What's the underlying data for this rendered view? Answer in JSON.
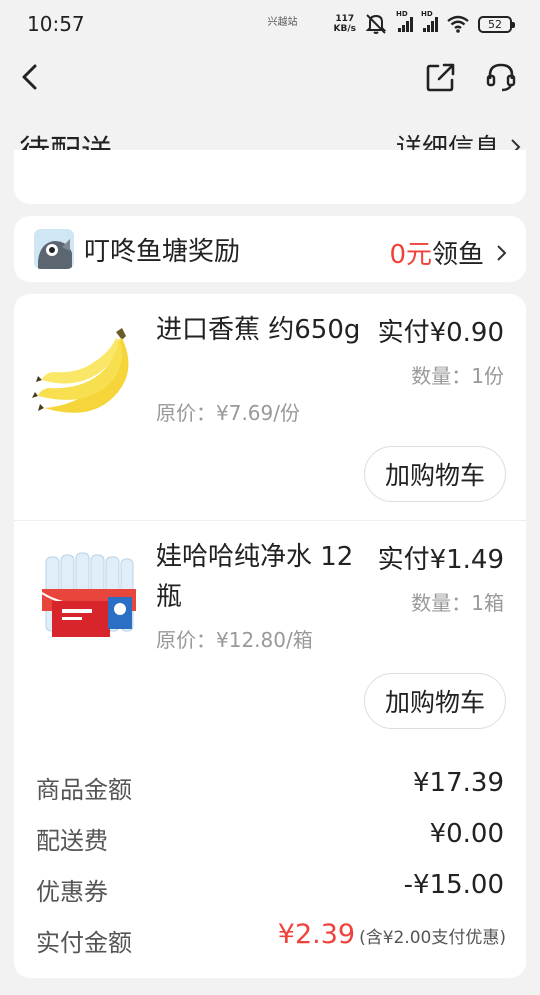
{
  "status_bar": {
    "time": "10:57",
    "carrier": "兴越站",
    "speed_value": "117",
    "speed_unit": "KB/s",
    "signal_badge": "HD",
    "battery": "52"
  },
  "header": {
    "title": "待配送",
    "detail_label": "详细信息"
  },
  "reward": {
    "title": "叮咚鱼塘奖励",
    "amount": "0元",
    "action": "领鱼"
  },
  "items": [
    {
      "name": "进口香蕉 约650g",
      "paid": "实付¥0.90",
      "quantity": "数量：1份",
      "original_price": "原价：¥7.69/份",
      "add_cart_label": "加购物车"
    },
    {
      "name": "娃哈哈纯净水 12瓶",
      "paid": "实付¥1.49",
      "quantity": "数量：1箱",
      "original_price": "原价：¥12.80/箱",
      "add_cart_label": "加购物车"
    }
  ],
  "summary": {
    "goods_label": "商品金额",
    "goods_value": "¥17.39",
    "delivery_label": "配送费",
    "delivery_value": "¥0.00",
    "coupon_label": "优惠券",
    "coupon_value": "-¥15.00",
    "paid_label": "实付金额",
    "paid_value": "¥2.39",
    "paid_note": "(含¥2.00支付优惠)"
  },
  "colors": {
    "accent": "#f0423c",
    "background": "#f2f2f2",
    "card": "#ffffff"
  },
  "icons": [
    "back-arrow-icon",
    "share-icon",
    "customer-service-icon",
    "chevron-right-icon",
    "fish-reward-icon"
  ]
}
